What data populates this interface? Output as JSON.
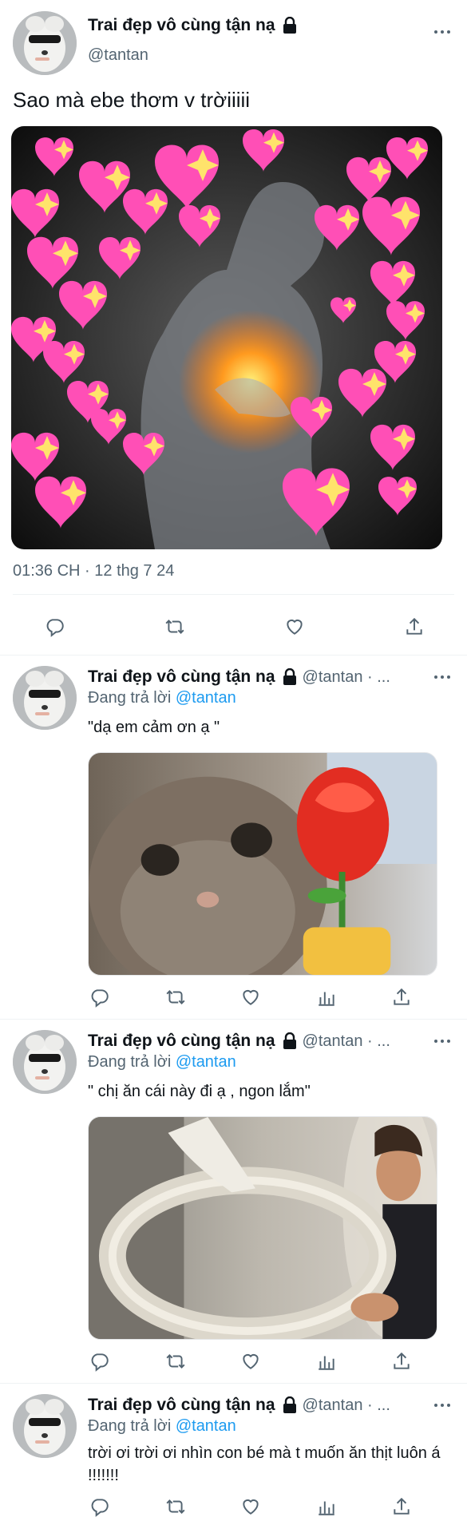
{
  "main_tweet": {
    "display_name": "Trai đẹp vô cùng tận nạ",
    "handle": "@tantan",
    "text": "Sao mà ebe thơm v trờiiiii",
    "timestamp": "01:36 CH · 12 thg 7 24",
    "media_icon": "hearts-meme-image"
  },
  "replies": [
    {
      "display_name": "Trai đẹp vô cùng tận nạ",
      "handle": "@tantan · ...",
      "replying_prefix": "Đang trả lời ",
      "replying_to": "@tantan",
      "text": "\"dạ em cảm ơn ạ \"",
      "media_icon": "kitten-rose-image"
    },
    {
      "display_name": "Trai đẹp vô cùng tận nạ",
      "handle": "@tantan · ...",
      "replying_prefix": "Đang trả lời ",
      "replying_to": "@tantan",
      "text": "\" chị ăn cái này đi ạ , ngon lắm\"",
      "media_icon": "ring-meme-image"
    },
    {
      "display_name": "Trai đẹp vô cùng tận nạ",
      "handle": "@tantan · ...",
      "replying_prefix": "Đang trả lời ",
      "replying_to": "@tantan",
      "text": "trời ơi trời ơi nhìn con bé mà t muốn ăn thịt luôn á !!!!!!!"
    }
  ],
  "colors": {
    "text": "#0f1419",
    "secondary": "#536471",
    "link": "#1d9bf0",
    "divider": "#eff3f4",
    "heart": "#ff4fb6"
  }
}
